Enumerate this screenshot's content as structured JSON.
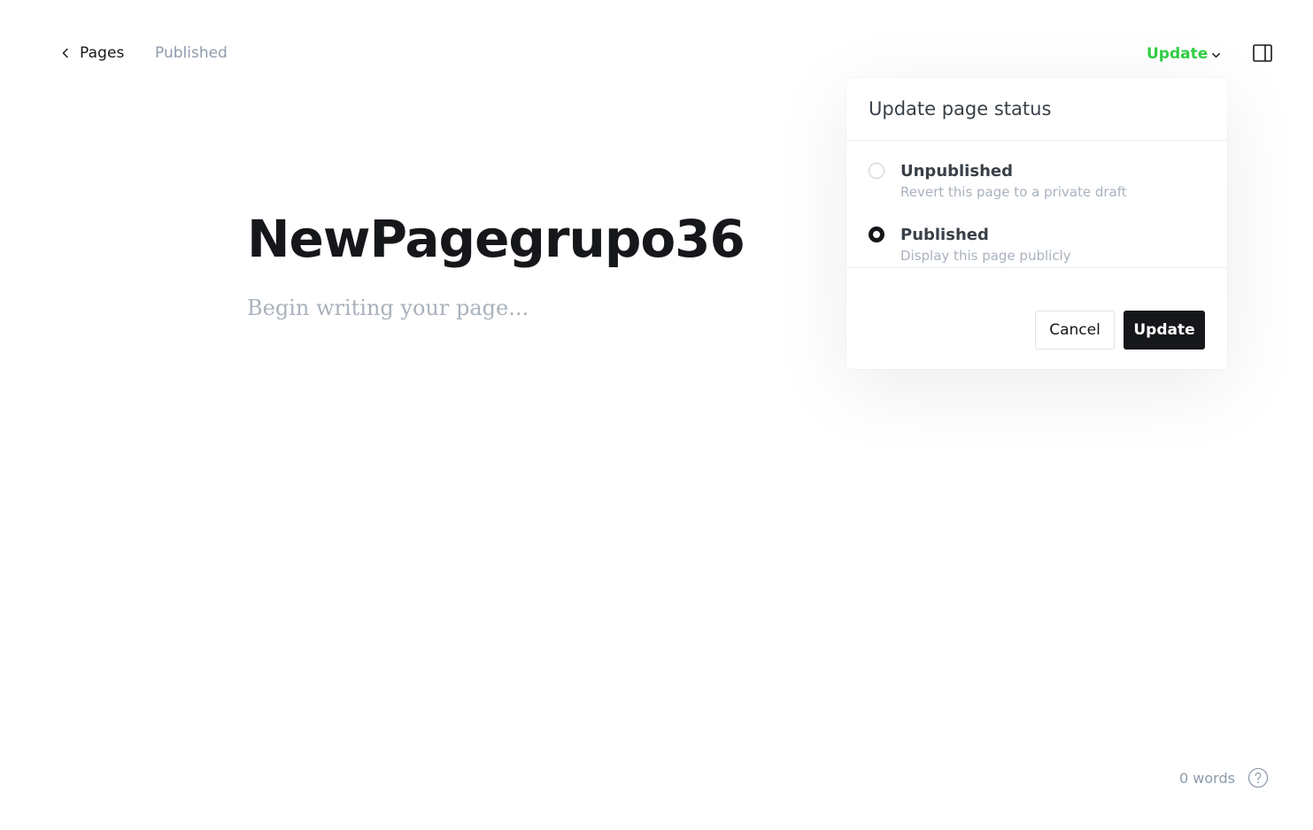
{
  "header": {
    "back_label": "Pages",
    "post_status": "Published",
    "update_label": "Update"
  },
  "editor": {
    "title": "NewPagegrupo36",
    "body_placeholder": "Begin writing your page..."
  },
  "popover": {
    "title": "Update page status",
    "options": [
      {
        "label": "Unpublished",
        "description": "Revert this page to a private draft",
        "selected": false
      },
      {
        "label": "Published",
        "description": "Display this page publicly",
        "selected": true
      }
    ],
    "cancel_label": "Cancel",
    "confirm_label": "Update"
  },
  "footer": {
    "word_count": "0 words"
  },
  "colors": {
    "accent_green": "#30cf43",
    "text_dark": "#15171a",
    "text_muted": "#8e9cac"
  },
  "icons": {
    "back": "chevron-left-icon",
    "dropdown": "chevron-down-icon",
    "sidebar": "sidebar-toggle-icon",
    "help": "question-circle-icon"
  }
}
